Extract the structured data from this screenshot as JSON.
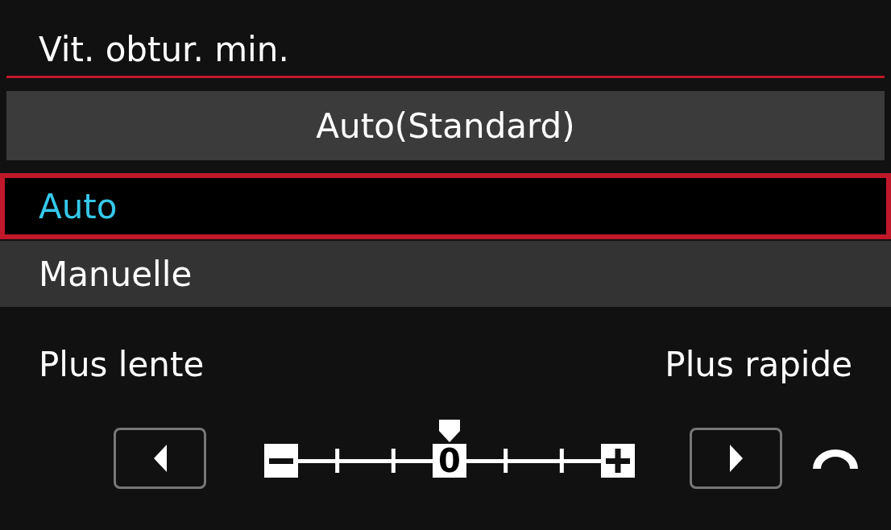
{
  "title": "Vit. obtur. min.",
  "current_setting": "Auto(Standard)",
  "options": [
    {
      "label": "Auto",
      "selected": true
    },
    {
      "label": "Manuelle",
      "selected": false
    }
  ],
  "scale": {
    "left_label": "Plus lente",
    "right_label": "Plus rapide",
    "center_label": "0"
  }
}
